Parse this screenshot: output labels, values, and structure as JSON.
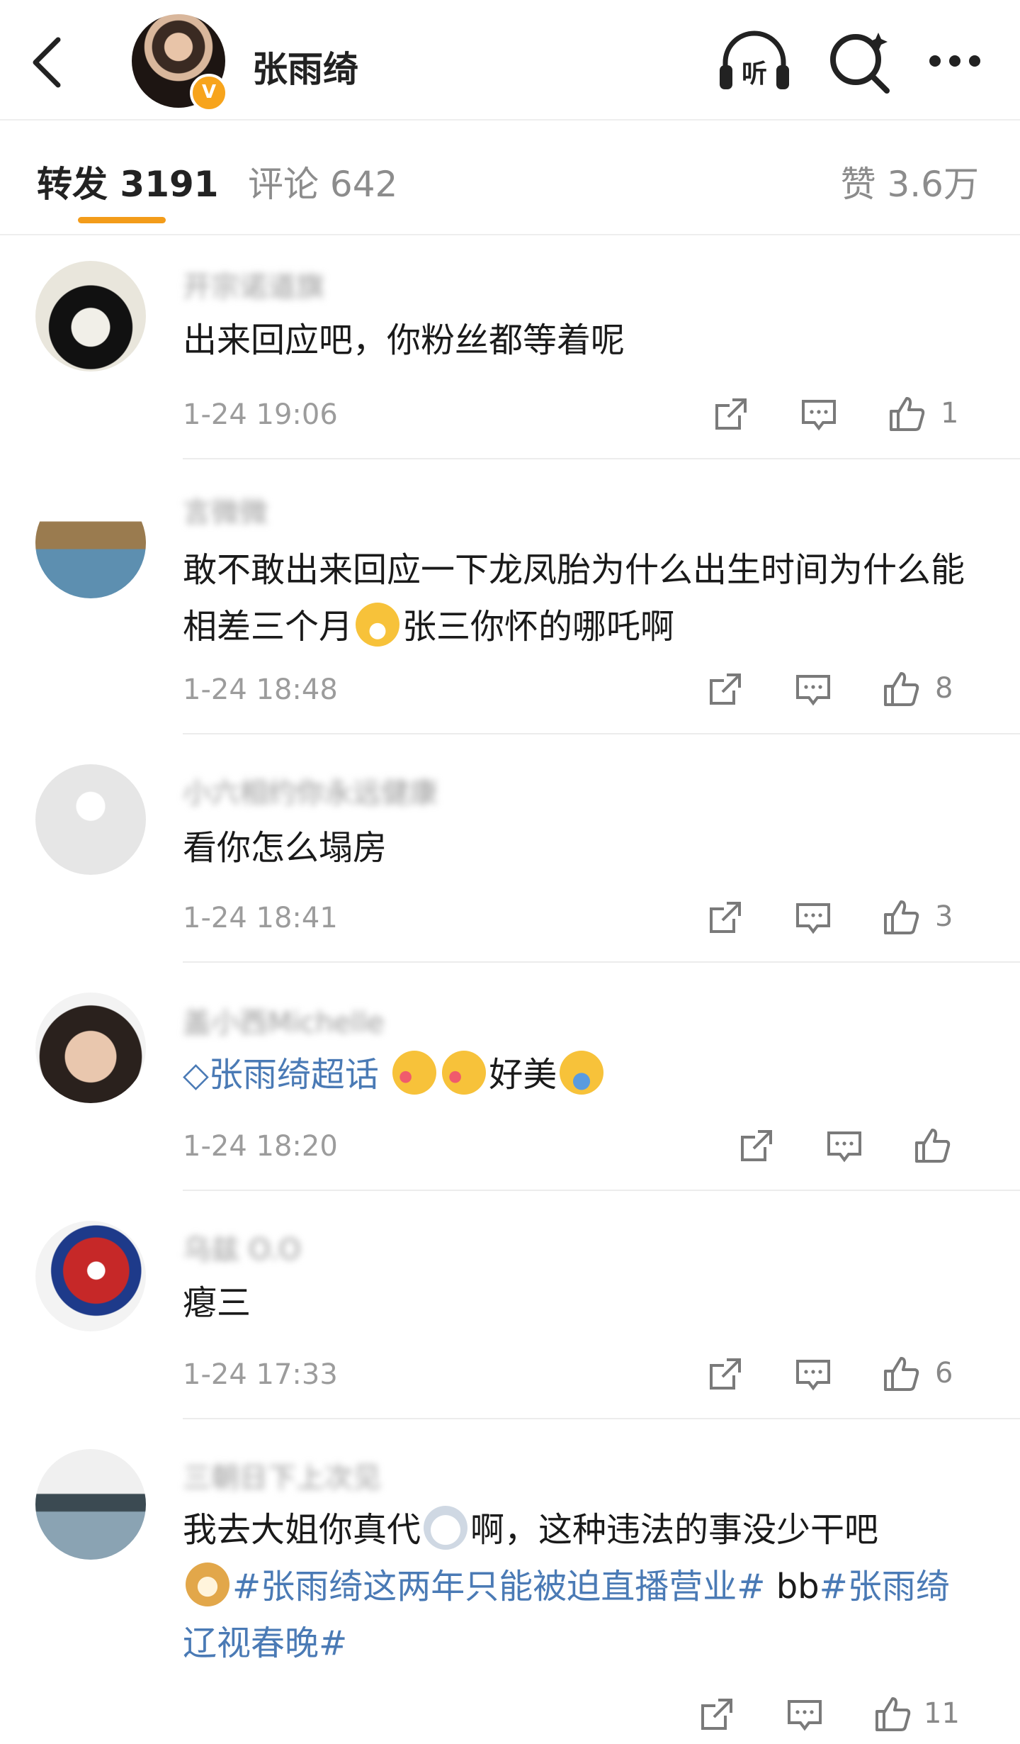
{
  "header": {
    "title": "张雨绮",
    "verified_badge": "V",
    "icons": [
      "back-chevron-icon",
      "listen-headphones-icon",
      "search-icon",
      "more-dots-icon"
    ],
    "listen_label": "听"
  },
  "tabs": {
    "repost": "转发 3191",
    "comments": "评论 642",
    "likes": "赞 3.6万"
  },
  "accent_colors": {
    "tab_underline": "#f39c1a",
    "link": "#4a7ab5",
    "verified": "#f7a41c"
  },
  "comments": [
    {
      "text": "出来回应吧，你粉丝都等着呢",
      "time": "1-24 19:06",
      "likes": "1"
    },
    {
      "text_before": "敢不敢出来回应一下龙凤胎为什么出生时间为什么能相差三个月",
      "emoji": "grinning-face-emoji",
      "text_after": "张三你怀的哪吒啊",
      "time": "1-24 18:48",
      "likes": "8"
    },
    {
      "text": "看你怎么塌房",
      "time": "1-24 18:41",
      "likes": "3"
    },
    {
      "tag": "张雨绮超话",
      "text_after": "好美",
      "emojis": [
        "kissing-heart-emoji",
        "kissing-heart-emoji",
        "hugging-face-emoji"
      ],
      "time": "1-24 18:20",
      "likes": ""
    },
    {
      "text": "瘪三",
      "time": "1-24 17:33",
      "likes": "6"
    },
    {
      "text_before": "我去大姐你真代",
      "emoji": "cloud-emoji",
      "text_mid": "啊，这种违法的事没少干吧",
      "emoji2": "doge-emoji",
      "tag1": "#张雨绮这两年只能被迫直播营业#",
      "text_plain": " bb",
      "tag2": "#张雨绮 辽视春晚#",
      "time": "",
      "likes": "11"
    }
  ]
}
